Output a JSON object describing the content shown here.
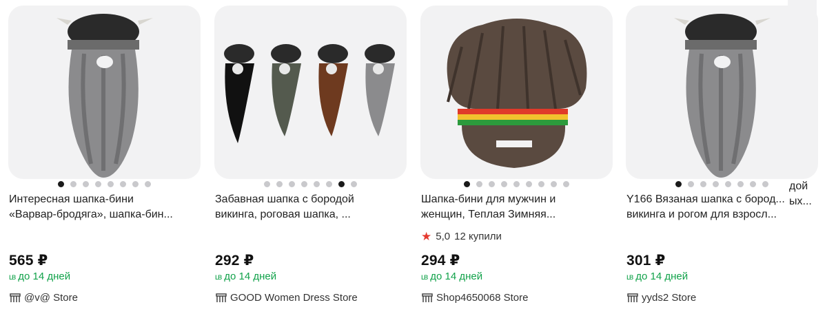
{
  "products": [
    {
      "title_lines": [
        "Интересная шапка-бини",
        "«Варвар-бродяга», шапка-бин..."
      ],
      "price": "565 ₽",
      "delivery": "до 14 дней",
      "store": "@v@ Store",
      "image_icon": "viking-beard-hat-gray",
      "dots": 8,
      "active_dot": 0
    },
    {
      "title_lines": [
        "Забавная шапка с бородой",
        "викинга, роговая шапка, ..."
      ],
      "price": "292 ₽",
      "delivery": "до 14 дней",
      "store": "GOOD Women Dress Store",
      "image_icon": "four-viking-beard-hats",
      "dots": 8,
      "active_dot": 6
    },
    {
      "title_lines": [
        "Шапка-бини для мужчин и",
        "женщин, Теплая Зимняя..."
      ],
      "rating": "5,0",
      "purchases": "12 купили",
      "price": "294 ₽",
      "delivery": "до 14 дней",
      "store": "Shop4650068 Store",
      "image_icon": "rasta-hair-beard-hat",
      "dots": 9,
      "active_dot": 0
    },
    {
      "title_lines": [
        "Y166 Вязаная шапка с бород...",
        "викинга и рогом для взросл..."
      ],
      "price": "301 ₽",
      "delivery": "до 14 дней",
      "store": "yyds2 Store",
      "image_icon": "viking-beard-hat-gray",
      "dots": 8,
      "active_dot": 0
    }
  ],
  "overflow": {
    "line1": "дой",
    "line2": "ых..."
  },
  "colors": {
    "delivery_green": "#11a24a",
    "star_red": "#e53a2f",
    "image_bg": "#f2f2f3"
  }
}
